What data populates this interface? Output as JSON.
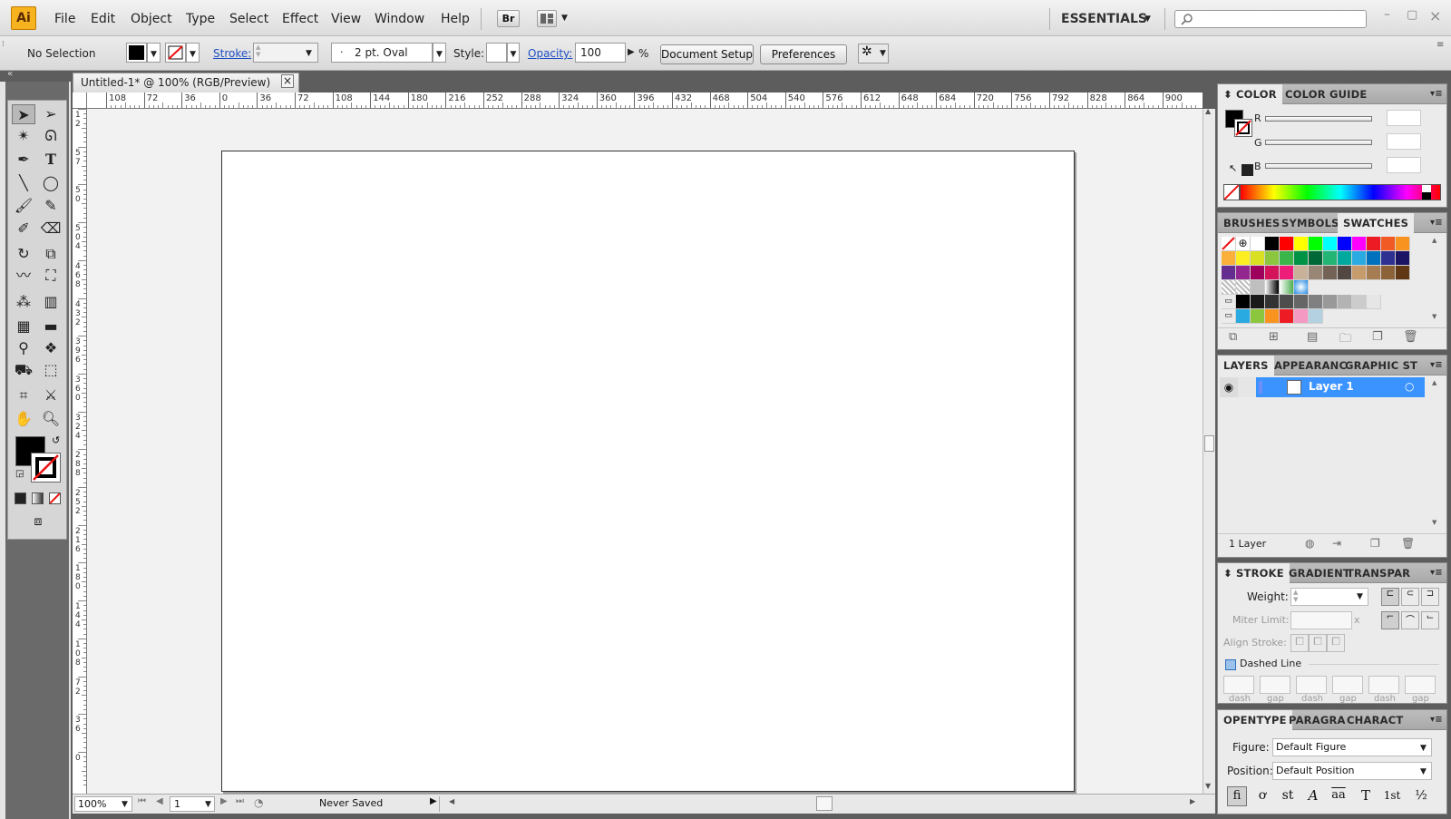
{
  "app": {
    "logo": "Ai",
    "workspace": "ESSENTIALS",
    "bridge_label": "Br"
  },
  "menu": [
    "File",
    "Edit",
    "Object",
    "Type",
    "Select",
    "Effect",
    "View",
    "Window",
    "Help"
  ],
  "control_bar": {
    "selection": "No Selection",
    "stroke_label": "Stroke:",
    "brush": "2 pt. Oval",
    "style_label": "Style:",
    "opacity_label": "Opacity:",
    "opacity_value": "100",
    "percent": "%",
    "document_setup": "Document Setup",
    "preferences": "Preferences"
  },
  "document": {
    "tab_title": "Untitled-1* @ 100% (RGB/Preview)",
    "close": "×",
    "h_ruler": [
      "108",
      "72",
      "36",
      "0",
      "36",
      "72",
      "108",
      "144",
      "180",
      "216",
      "252",
      "288",
      "324",
      "360",
      "396",
      "432",
      "468",
      "504",
      "540",
      "576",
      "612",
      "648",
      "684",
      "720",
      "756",
      "792",
      "828",
      "864",
      "900"
    ],
    "v_ruler": [
      "1 2",
      "5 7",
      "5 0",
      "5 0 4",
      "4 6 8",
      "4 3 2",
      "3 9 6",
      "3 6 0",
      "3 2 4",
      "2 8 8",
      "2 5 2",
      "2 1 6",
      "1 8 0",
      "1 4 4",
      "1 0 8",
      "7 2",
      "3 6",
      "0"
    ]
  },
  "status": {
    "zoom": "100%",
    "page": "1",
    "save_state": "Never Saved"
  },
  "panels": {
    "color": {
      "tabs": [
        "COLOR",
        "COLOR GUIDE"
      ],
      "channels": [
        "R",
        "G",
        "B"
      ]
    },
    "swatches": {
      "tabs": [
        "BRUSHES",
        "SYMBOLS",
        "SWATCHES"
      ]
    },
    "layers": {
      "tabs": [
        "LAYERS",
        "APPEARANC",
        "GRAPHIC ST"
      ],
      "layer_name": "Layer 1",
      "count": "1 Layer"
    },
    "stroke": {
      "tabs": [
        "STROKE",
        "GRADIENT",
        "TRANSPAR"
      ],
      "weight_label": "Weight:",
      "miter_label": "Miter Limit:",
      "miter_unit": "x",
      "align_label": "Align Stroke:",
      "dashed_label": "Dashed Line",
      "dash_labels": [
        "dash",
        "gap",
        "dash",
        "gap",
        "dash",
        "gap"
      ]
    },
    "opentype": {
      "tabs": [
        "OPENTYPE",
        "PARAGRA",
        "CHARACT"
      ],
      "figure_label": "Figure:",
      "figure_value": "Default Figure",
      "position_label": "Position:",
      "position_value": "Default Position",
      "glyph_buttons": [
        "fi",
        "ơ",
        "st",
        "A",
        "aa",
        "T",
        "1st",
        "½"
      ]
    }
  },
  "colors": {
    "accent_blue": "#3c8cf0",
    "layer_row": "#3b93ff",
    "logo": "#f6b31f"
  }
}
